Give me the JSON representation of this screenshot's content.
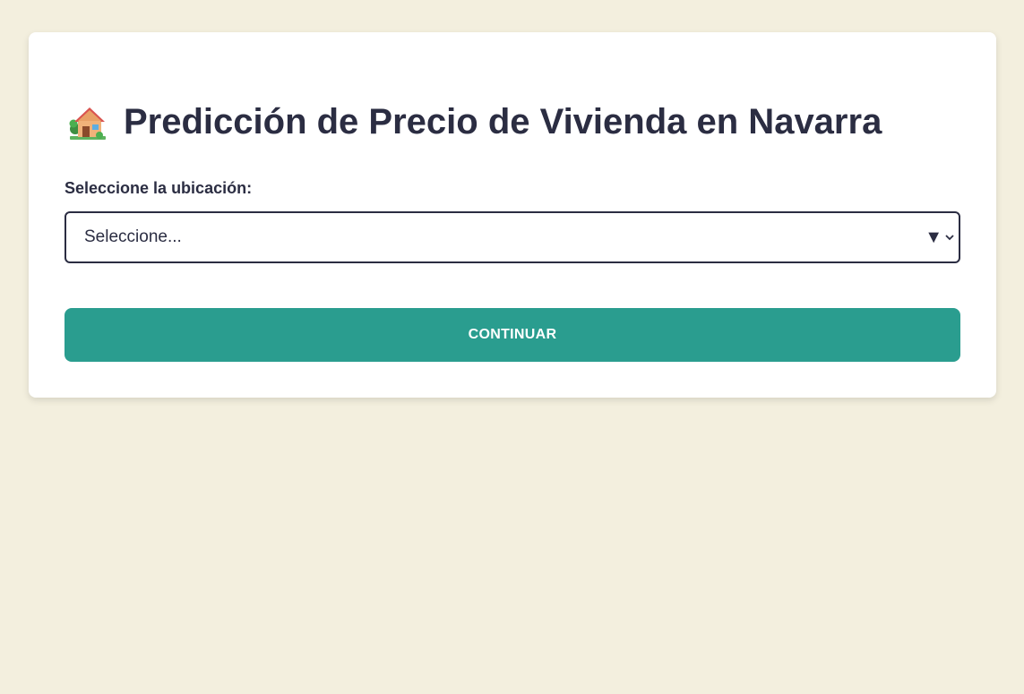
{
  "header": {
    "icon": "house-with-garden-icon",
    "title": "Predicción de Precio de Vivienda en Navarra"
  },
  "form": {
    "location_label": "Seleccione la ubicación:",
    "location_select": {
      "selected": "Seleccione...",
      "arrow_glyph": "▼"
    },
    "continue_label": "CONTINUAR"
  },
  "colors": {
    "background": "#f3efde",
    "card": "#ffffff",
    "text": "#2b2d42",
    "button": "#2a9d8f",
    "button_text": "#ffffff"
  }
}
